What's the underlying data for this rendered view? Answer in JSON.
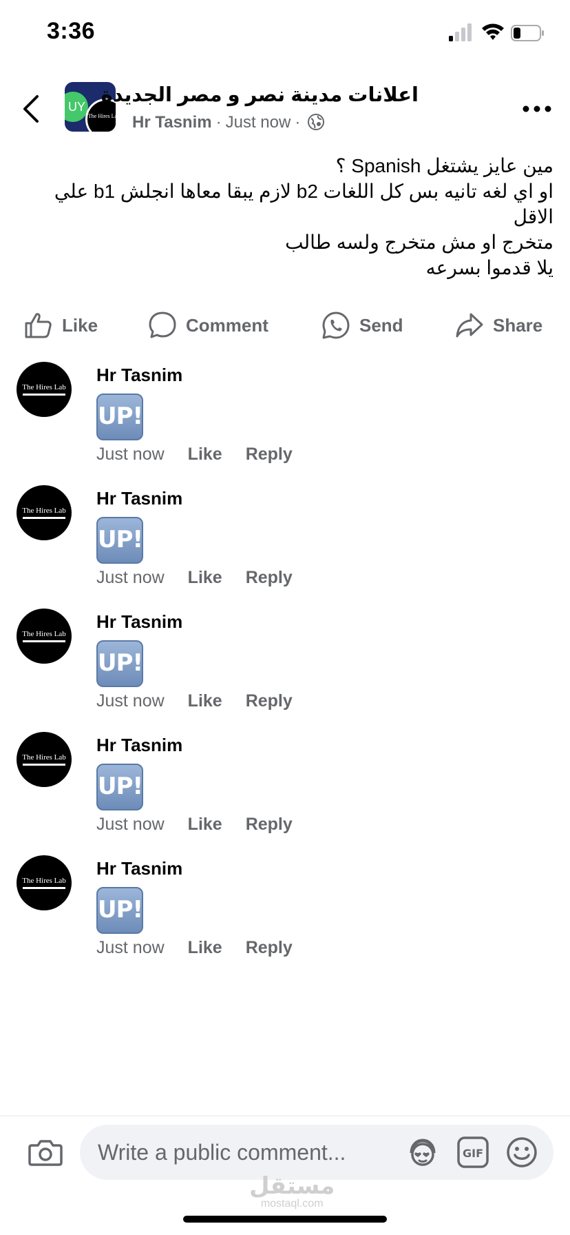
{
  "status_bar": {
    "time": "3:36"
  },
  "header": {
    "group_name": "اعلانات مدينة نصر و مصر الجديدة",
    "author": "Hr Tasnim",
    "timestamp": "Just now",
    "separator": "·",
    "avatar_brand": "The Hires Lab",
    "avatar_prefix": "UY"
  },
  "post": {
    "lines": [
      "مين عايز يشتغل Spanish ؟",
      "او اي لغه تانيه بس كل اللغات b2 لازم يبقا معاها انجلش b1 علي الاقل",
      "متخرج او مش متخرج ولسه طالب",
      "يلا قدموا بسرعه"
    ]
  },
  "actions": {
    "like": "Like",
    "comment": "Comment",
    "send": "Send",
    "share": "Share"
  },
  "comments": [
    {
      "author": "Hr Tasnim",
      "sticker": "UP!",
      "time": "Just now",
      "like": "Like",
      "reply": "Reply",
      "brand": "The Hires Lab"
    },
    {
      "author": "Hr Tasnim",
      "sticker": "UP!",
      "time": "Just now",
      "like": "Like",
      "reply": "Reply",
      "brand": "The Hires Lab"
    },
    {
      "author": "Hr Tasnim",
      "sticker": "UP!",
      "time": "Just now",
      "like": "Like",
      "reply": "Reply",
      "brand": "The Hires Lab"
    },
    {
      "author": "Hr Tasnim",
      "sticker": "UP!",
      "time": "Just now",
      "like": "Like",
      "reply": "Reply",
      "brand": "The Hires Lab"
    },
    {
      "author": "Hr Tasnim",
      "sticker": "UP!",
      "time": "Just now",
      "like": "Like",
      "reply": "Reply",
      "brand": "The Hires Lab"
    }
  ],
  "composer": {
    "placeholder": "Write a public comment...",
    "gif_label": "GIF"
  },
  "watermark": {
    "arabic": "مستقل",
    "latin": "mostaql.com"
  },
  "colors": {
    "secondary_text": "#65676b",
    "composer_bg": "#f0f2f5",
    "sticker_blue": "#6d8cb8"
  }
}
